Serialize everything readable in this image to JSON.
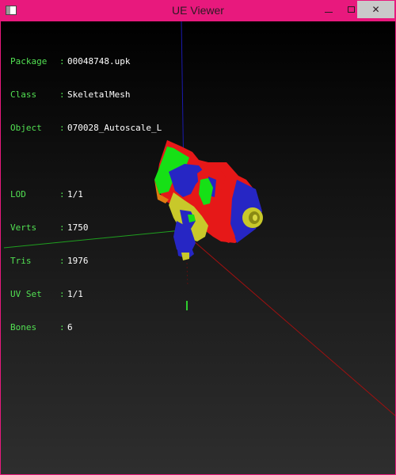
{
  "window": {
    "title": "UE Viewer",
    "colors": {
      "frame": "#e8197d",
      "close_bg": "#c9c9c9"
    }
  },
  "info": {
    "group1": [
      {
        "key": "Package",
        "value": "00048748.upk"
      },
      {
        "key": "Class",
        "value": "SkeletalMesh"
      },
      {
        "key": "Object",
        "value": "070028_Autoscale_L"
      }
    ],
    "group2": [
      {
        "key": "LOD",
        "value": "1/1"
      },
      {
        "key": "Verts",
        "value": "1750"
      },
      {
        "key": "Tris",
        "value": "1976"
      },
      {
        "key": "UV Set",
        "value": "1/1"
      },
      {
        "key": "Bones",
        "value": "6"
      }
    ]
  },
  "viewport": {
    "colors": {
      "label": "#52e052",
      "value": "#ffffff",
      "axis_x": "#d01010",
      "axis_y": "#1f9f1f",
      "axis_z": "#1a1ab0"
    },
    "model": "skeletal-mesh-preview"
  }
}
